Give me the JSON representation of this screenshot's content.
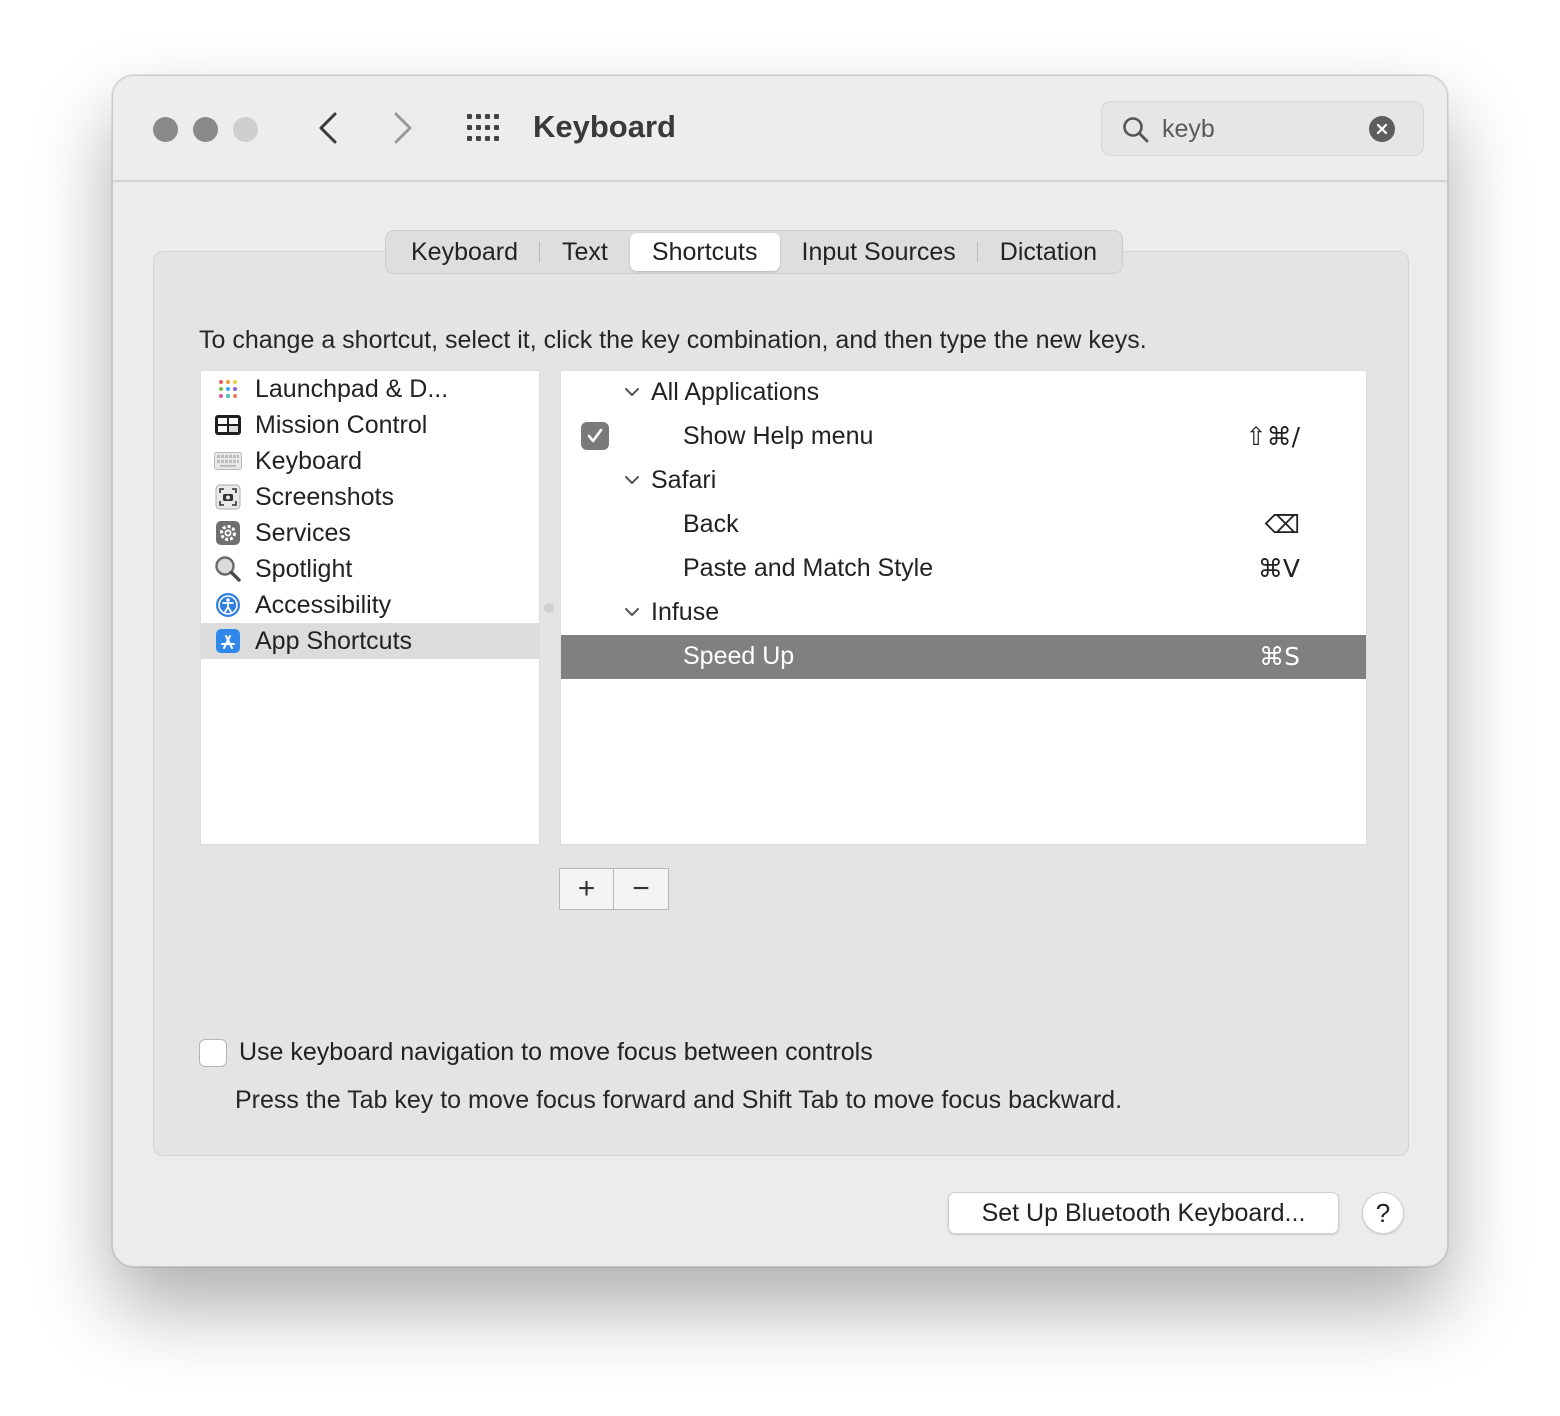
{
  "window": {
    "title": "Keyboard"
  },
  "search": {
    "value": "keyb"
  },
  "tabs": [
    {
      "label": "Keyboard",
      "active": false
    },
    {
      "label": "Text",
      "active": false
    },
    {
      "label": "Shortcuts",
      "active": true
    },
    {
      "label": "Input Sources",
      "active": false
    },
    {
      "label": "Dictation",
      "active": false
    }
  ],
  "instructions": "To change a shortcut, select it, click the key combination, and then type the new keys.",
  "categories": [
    {
      "label": "Launchpad & D...",
      "icon": "launchpad-icon",
      "selected": false
    },
    {
      "label": "Mission Control",
      "icon": "mission-control-icon",
      "selected": false
    },
    {
      "label": "Keyboard",
      "icon": "keyboard-icon",
      "selected": false
    },
    {
      "label": "Screenshots",
      "icon": "screenshot-icon",
      "selected": false
    },
    {
      "label": "Services",
      "icon": "gear-icon",
      "selected": false
    },
    {
      "label": "Spotlight",
      "icon": "magnifier-icon",
      "selected": false
    },
    {
      "label": "Accessibility",
      "icon": "accessibility-icon",
      "selected": false
    },
    {
      "label": "App Shortcuts",
      "icon": "app-store-icon",
      "selected": true
    }
  ],
  "shortcuts": {
    "groups": [
      {
        "name": "All Applications",
        "items": [
          {
            "label": "Show Help menu",
            "key": "⇧⌘/",
            "checked": true
          }
        ]
      },
      {
        "name": "Safari",
        "items": [
          {
            "label": "Back",
            "key": "⌫"
          },
          {
            "label": "Paste and Match Style",
            "key": "⌘V"
          }
        ]
      },
      {
        "name": "Infuse",
        "items": [
          {
            "label": "Speed Up",
            "key": "⌘S",
            "selected": true
          }
        ]
      }
    ]
  },
  "controls": {
    "add": "+",
    "remove": "−"
  },
  "keyboard_nav": {
    "label": "Use keyboard navigation to move focus between controls",
    "hint": "Press the Tab key to move focus forward and Shift Tab to move focus backward.",
    "checked": false
  },
  "footer": {
    "bluetooth_button": "Set Up Bluetooth Keyboard...",
    "help": "?"
  },
  "colors": {
    "selection": "#808080",
    "window_bg": "#ececec"
  }
}
